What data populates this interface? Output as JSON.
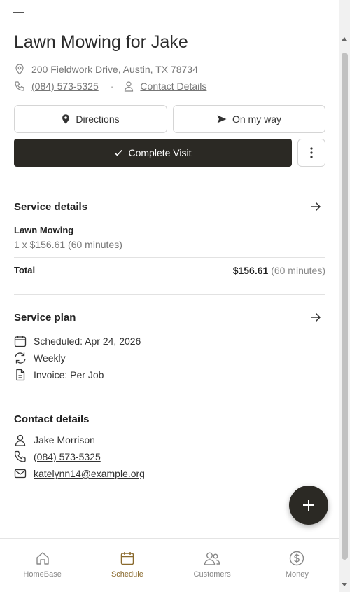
{
  "title": "Lawn Mowing for Jake",
  "address": "200 Fieldwork Drive, Austin, TX 78734",
  "phone": "(084) 573-5325",
  "contact_details_link": "Contact Details",
  "actions": {
    "directions": "Directions",
    "on_my_way": "On my way",
    "complete_visit": "Complete Visit"
  },
  "service_details": {
    "heading": "Service details",
    "item_name": "Lawn Mowing",
    "item_qty": "1 x $156.61 (60 minutes)",
    "total_label": "Total",
    "total_amount": "$156.61",
    "total_duration": "(60 minutes)"
  },
  "service_plan": {
    "heading": "Service plan",
    "scheduled": "Scheduled: Apr 24, 2026",
    "frequency": "Weekly",
    "invoice": "Invoice: Per Job"
  },
  "contact": {
    "heading": "Contact details",
    "name": "Jake Morrison",
    "phone": "(084) 573-5325",
    "email": "katelynn14@example.org"
  },
  "nav": {
    "items": [
      {
        "label": "HomeBase",
        "icon": "home-icon"
      },
      {
        "label": "Schedule",
        "icon": "calendar-icon"
      },
      {
        "label": "Customers",
        "icon": "users-icon"
      },
      {
        "label": "Money",
        "icon": "dollar-icon"
      }
    ],
    "active": "Schedule"
  },
  "colors": {
    "primary_dark": "#2b2924",
    "active_nav": "#8a6a2e"
  }
}
